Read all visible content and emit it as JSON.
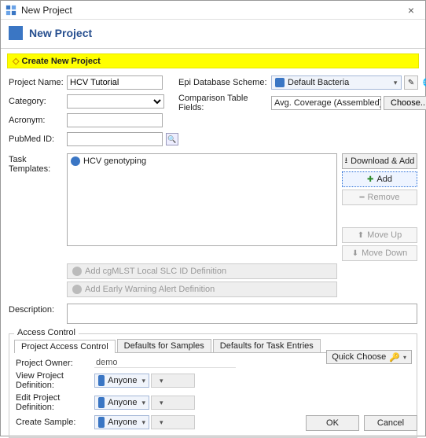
{
  "window": {
    "title": "New Project"
  },
  "header": {
    "title": "New Project"
  },
  "banner": {
    "text": "Create New Project"
  },
  "form": {
    "projectName": {
      "label": "Project Name:",
      "value": "HCV Tutorial"
    },
    "category": {
      "label": "Category:"
    },
    "acronym": {
      "label": "Acronym:"
    },
    "pubmed": {
      "label": "PubMed ID:"
    },
    "epiScheme": {
      "label": "Epi Database Scheme:",
      "value": "Default Bacteria"
    },
    "ctf": {
      "label": "Comparison Table Fields:",
      "value": "Avg. Coverage (Assembled), Approximate…",
      "chooseLabel": "Choose..."
    },
    "templates": {
      "label": "Task Templates:",
      "items": [
        {
          "name": "HCV genotyping"
        }
      ],
      "buttons": {
        "downloadAdd": "Download & Add",
        "add": "Add",
        "remove": "Remove",
        "moveUp": "Move Up",
        "moveDown": "Move Down"
      },
      "under": {
        "cgmlst": "Add cgMLST Local SLC ID Definition",
        "early": "Add Early Warning Alert Definition"
      }
    },
    "description": {
      "label": "Description:",
      "value": ""
    }
  },
  "accessControl": {
    "legend": "Access Control",
    "tabs": {
      "pac": "Project Access Control",
      "samples": "Defaults for Samples",
      "tasks": "Defaults for Task Entries"
    },
    "quickChoose": "Quick Choose",
    "owner": {
      "label": "Project Owner:",
      "value": "demo"
    },
    "viewDef": {
      "label": "View Project Definition:",
      "value": "Anyone"
    },
    "editDef": {
      "label": "Edit Project Definition:",
      "value": "Anyone"
    },
    "createSample": {
      "label": "Create Sample:",
      "value": "Anyone"
    }
  },
  "footer": {
    "ok": "OK",
    "cancel": "Cancel"
  }
}
